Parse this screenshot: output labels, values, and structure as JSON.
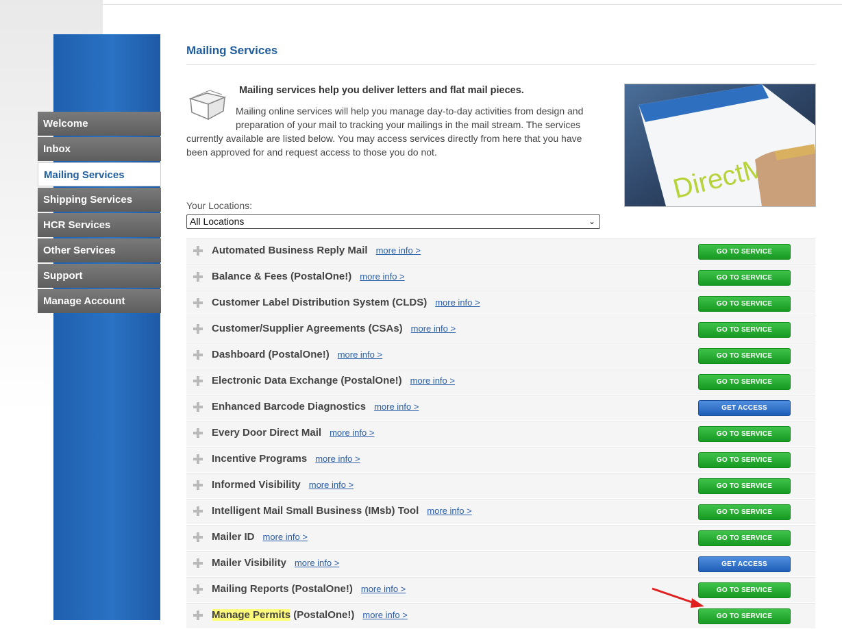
{
  "sidebar": {
    "items": [
      {
        "label": "Welcome"
      },
      {
        "label": "Inbox"
      },
      {
        "label": "Mailing Services"
      },
      {
        "label": "Shipping Services"
      },
      {
        "label": "HCR Services"
      },
      {
        "label": "Other Services"
      },
      {
        "label": "Support"
      },
      {
        "label": "Manage Account"
      }
    ],
    "active": "Mailing Services"
  },
  "main": {
    "title": "Mailing Services",
    "headline": "Mailing services help you deliver letters and flat mail pieces.",
    "description": "Mailing online services will help you manage day-to-day activities from design and preparation of your mail to tracking your mailings in the mail stream. The services currently available are listed below. You may access services directly from here that you have been approved for and request access to those you do not.",
    "photo_text": "DirectMail",
    "locations_label": "Your Locations:",
    "locations_value": "All Locations",
    "more_info_label": "more info >",
    "services": [
      {
        "name": "Automated Business Reply Mail",
        "button": "GO TO SERVICE",
        "type": "go"
      },
      {
        "name": "Balance & Fees (PostalOne!)",
        "button": "GO TO SERVICE",
        "type": "go"
      },
      {
        "name": "Customer Label Distribution System (CLDS)",
        "button": "GO TO SERVICE",
        "type": "go"
      },
      {
        "name": "Customer/Supplier Agreements (CSAs)",
        "button": "GO TO SERVICE",
        "type": "go"
      },
      {
        "name": "Dashboard (PostalOne!)",
        "button": "GO TO SERVICE",
        "type": "go"
      },
      {
        "name": "Electronic Data Exchange (PostalOne!)",
        "button": "GO TO SERVICE",
        "type": "go"
      },
      {
        "name": "Enhanced Barcode Diagnostics",
        "button": "GET ACCESS",
        "type": "access"
      },
      {
        "name": "Every Door Direct Mail",
        "button": "GO TO SERVICE",
        "type": "go"
      },
      {
        "name": "Incentive Programs",
        "button": "GO TO SERVICE",
        "type": "go"
      },
      {
        "name": "Informed Visibility",
        "button": "GO TO SERVICE",
        "type": "go"
      },
      {
        "name": "Intelligent Mail Small Business (IMsb) Tool",
        "button": "GO TO SERVICE",
        "type": "go"
      },
      {
        "name": "Mailer ID",
        "button": "GO TO SERVICE",
        "type": "go"
      },
      {
        "name": "Mailer Visibility",
        "button": "GET ACCESS",
        "type": "access"
      },
      {
        "name": "Mailing Reports (PostalOne!)",
        "button": "GO TO SERVICE",
        "type": "go"
      },
      {
        "name_highlight": "Manage Permits",
        "name": " (PostalOne!)",
        "button": "GO TO SERVICE",
        "type": "go"
      }
    ]
  },
  "colors": {
    "accent": "#1f5e9e",
    "go_button": "#22a82d",
    "access_button": "#2a6bc7",
    "highlight": "#fffb7a",
    "arrow": "#e02020"
  }
}
